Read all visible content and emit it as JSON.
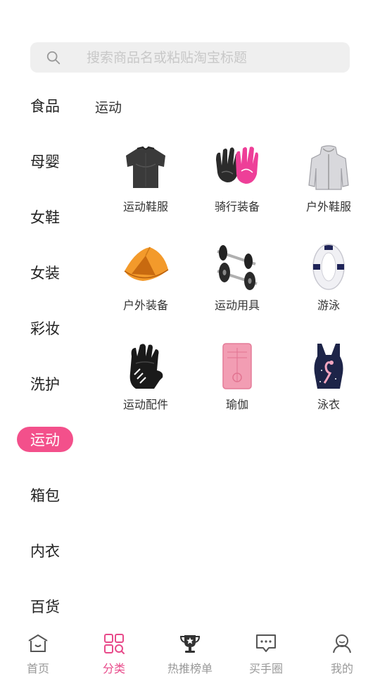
{
  "search": {
    "placeholder": "搜索商品名或粘贴淘宝标题"
  },
  "sidebar": {
    "items": [
      {
        "label": "食品"
      },
      {
        "label": "母婴"
      },
      {
        "label": "女鞋"
      },
      {
        "label": "女装"
      },
      {
        "label": "彩妆"
      },
      {
        "label": "洗护"
      },
      {
        "label": "运动",
        "active": true
      },
      {
        "label": "箱包"
      },
      {
        "label": "内衣"
      },
      {
        "label": "百货"
      }
    ]
  },
  "main": {
    "section_title": "运动",
    "items": [
      {
        "label": "运动鞋服",
        "icon": "compression-shirt-icon"
      },
      {
        "label": "骑行装备",
        "icon": "cycling-gloves-icon"
      },
      {
        "label": "户外鞋服",
        "icon": "outdoor-jacket-icon"
      },
      {
        "label": "户外装备",
        "icon": "tent-icon"
      },
      {
        "label": "运动用具",
        "icon": "dumbbell-icon"
      },
      {
        "label": "游泳",
        "icon": "swim-ring-icon"
      },
      {
        "label": "运动配件",
        "icon": "training-glove-icon"
      },
      {
        "label": "瑜伽",
        "icon": "yoga-mat-icon"
      },
      {
        "label": "泳衣",
        "icon": "swimsuit-icon"
      }
    ]
  },
  "tabbar": {
    "tabs": [
      {
        "label": "首页",
        "icon": "home-icon"
      },
      {
        "label": "分类",
        "icon": "category-icon",
        "active": true
      },
      {
        "label": "热推榜单",
        "icon": "trophy-icon"
      },
      {
        "label": "买手圈",
        "icon": "chat-icon"
      },
      {
        "label": "我的",
        "icon": "user-icon"
      }
    ]
  },
  "colors": {
    "accent": "#f3508b",
    "tab_active": "#e84a8a",
    "search_bg": "#efefef"
  }
}
